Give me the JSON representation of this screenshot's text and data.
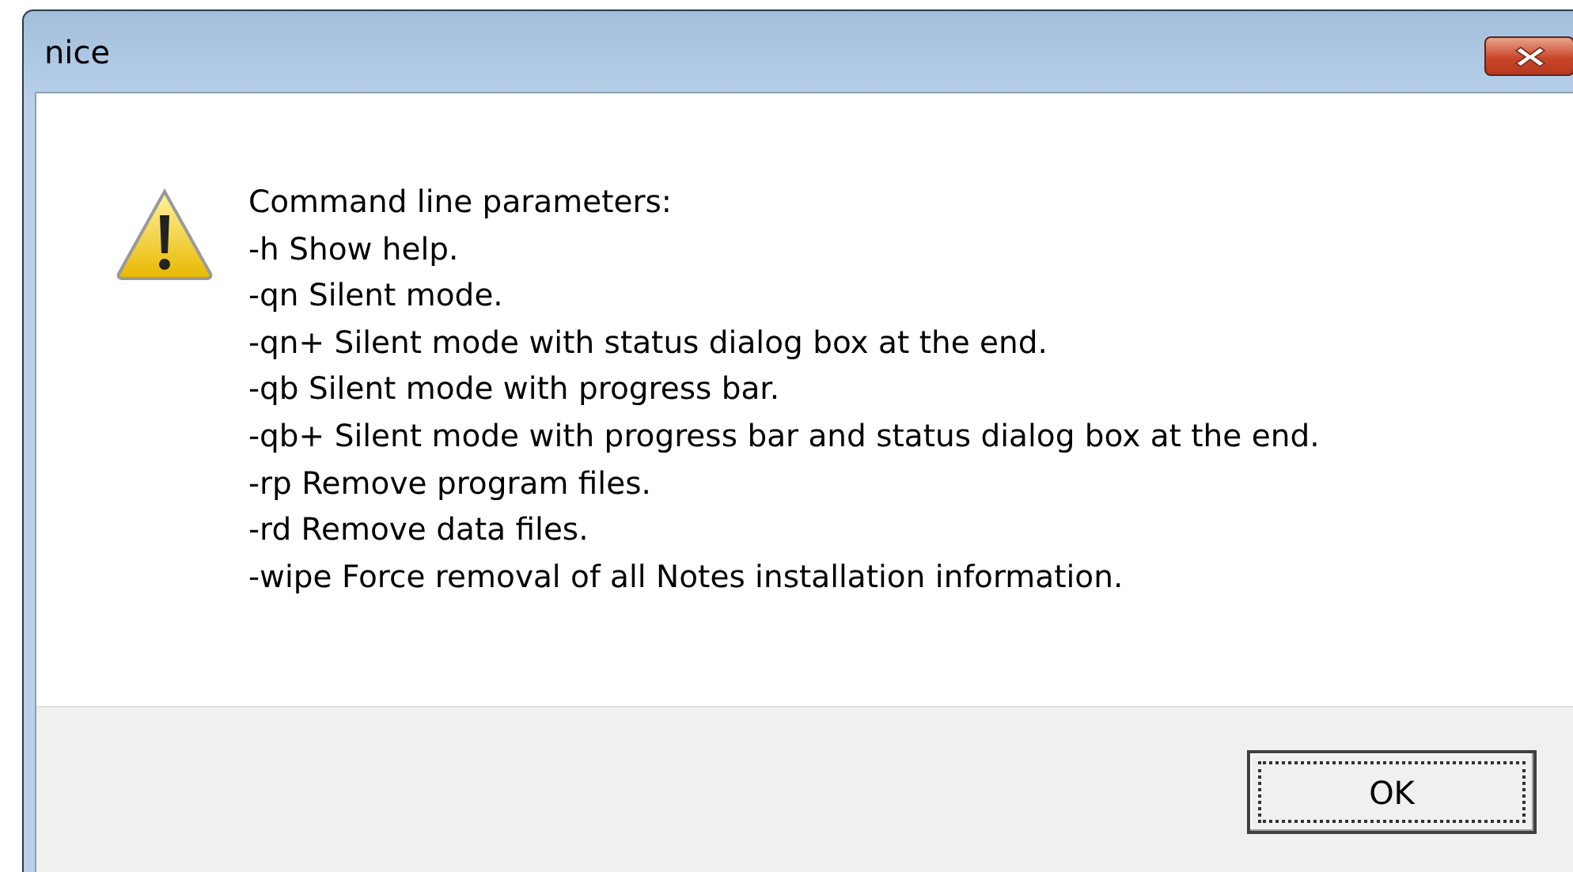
{
  "window": {
    "title": "nice"
  },
  "message": {
    "lines": [
      "Command line parameters:",
      "-h Show help.",
      "-qn Silent mode.",
      "-qn+ Silent mode with status dialog box at the end.",
      "-qb Silent mode with progress bar.",
      "-qb+ Silent mode with progress bar and status dialog box at the end.",
      "-rp Remove program files.",
      "-rd Remove data files.",
      "-wipe Force removal of all Notes installation information."
    ]
  },
  "buttons": [
    {
      "label": "OK",
      "selected": true
    }
  ]
}
